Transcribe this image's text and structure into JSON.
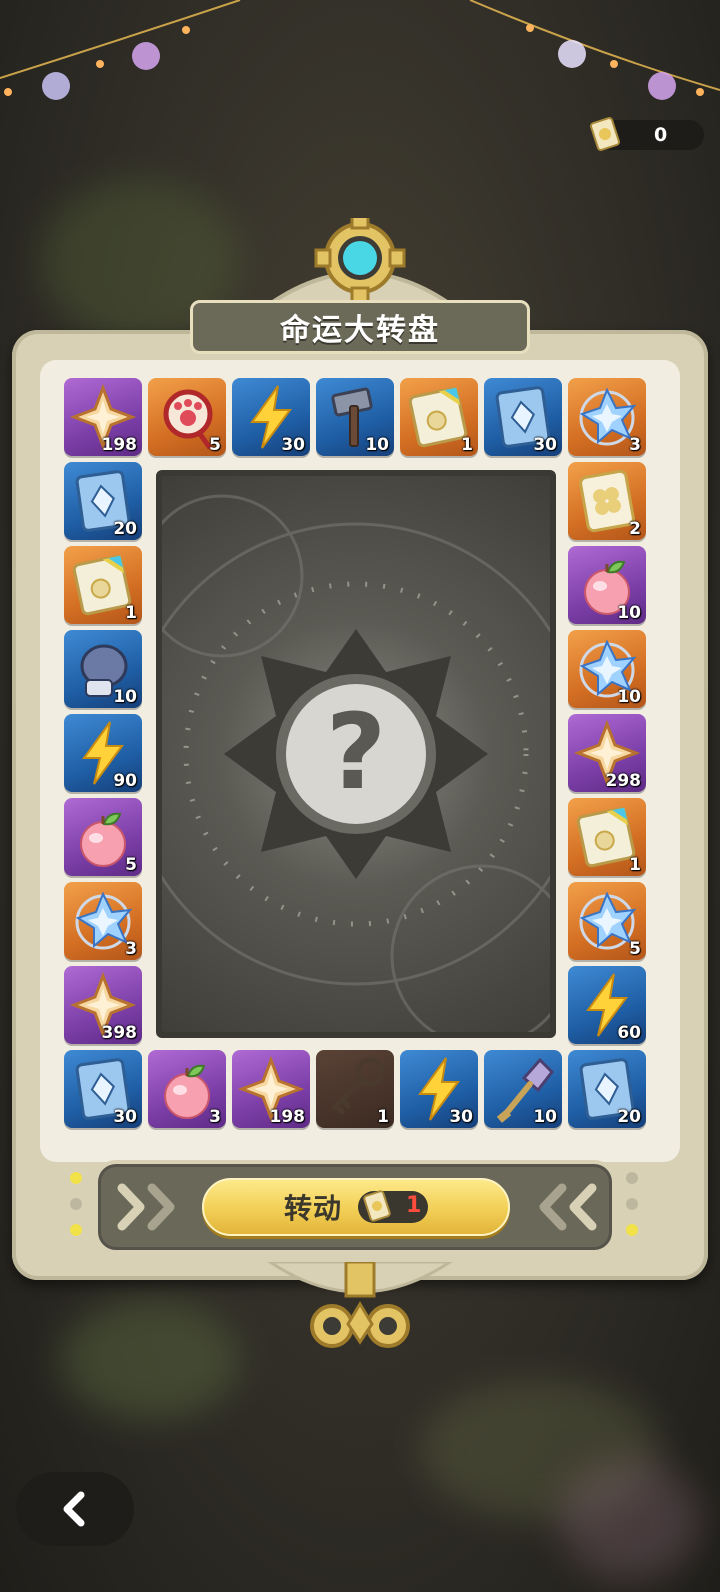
{
  "header": {
    "ticket_count": "0",
    "title": "命运大转盘"
  },
  "colors": {
    "accent_gold": "#f2cf55",
    "cost_red": "#ff4d3d",
    "panel_beige": "#d8d1b6",
    "title_plate": "#6b6958"
  },
  "board": {
    "tiles": [
      {
        "item": "gold-star-crystal",
        "bg": "purple",
        "count": "198"
      },
      {
        "item": "paw-badge",
        "bg": "orange",
        "count": "5"
      },
      {
        "item": "lightning",
        "bg": "blue",
        "count": "30"
      },
      {
        "item": "hammer",
        "bg": "blue",
        "count": "10"
      },
      {
        "item": "rainbow-ticket",
        "bg": "orange",
        "count": "1"
      },
      {
        "item": "blue-card",
        "bg": "blue",
        "count": "30"
      },
      {
        "item": "blue-crystal",
        "bg": "orange",
        "count": "3"
      },
      {
        "item": "clover-ticket",
        "bg": "orange",
        "count": "2"
      },
      {
        "item": "peach",
        "bg": "purple",
        "count": "10"
      },
      {
        "item": "blue-crystal",
        "bg": "orange",
        "count": "10"
      },
      {
        "item": "gold-star-crystal",
        "bg": "purple",
        "count": "298"
      },
      {
        "item": "rainbow-ticket",
        "bg": "orange",
        "count": "1"
      },
      {
        "item": "blue-crystal",
        "bg": "orange",
        "count": "5"
      },
      {
        "item": "lightning",
        "bg": "blue",
        "count": "60"
      },
      {
        "item": "blue-card",
        "bg": "blue",
        "count": "20"
      },
      {
        "item": "shovel",
        "bg": "blue",
        "count": "10"
      },
      {
        "item": "lightning",
        "bg": "blue",
        "count": "30"
      },
      {
        "item": "key",
        "bg": "dark",
        "count": "1"
      },
      {
        "item": "gold-star-crystal",
        "bg": "purple",
        "count": "198"
      },
      {
        "item": "peach",
        "bg": "purple",
        "count": "3"
      },
      {
        "item": "blue-card",
        "bg": "blue",
        "count": "30"
      },
      {
        "item": "gold-star-crystal",
        "bg": "purple",
        "count": "398"
      },
      {
        "item": "blue-crystal",
        "bg": "orange",
        "count": "3"
      },
      {
        "item": "peach",
        "bg": "purple",
        "count": "5"
      },
      {
        "item": "lightning",
        "bg": "blue",
        "count": "90"
      },
      {
        "item": "boxing-glove",
        "bg": "blue",
        "count": "10"
      },
      {
        "item": "rainbow-ticket",
        "bg": "orange",
        "count": "1"
      },
      {
        "item": "blue-card",
        "bg": "blue",
        "count": "20"
      }
    ],
    "center_symbol": "?"
  },
  "spin": {
    "label": "转动",
    "cost": "1"
  },
  "icons": {
    "back": "chevron-left-icon",
    "ticket": "ticket-icon",
    "arrows_left": "double-chevron-right-icon",
    "arrows_right": "double-chevron-left-icon"
  }
}
